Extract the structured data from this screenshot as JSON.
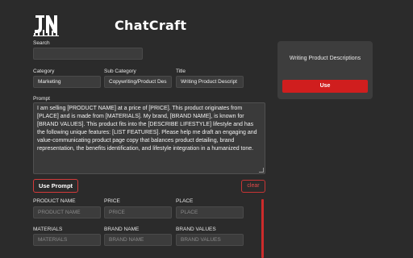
{
  "app": {
    "title": "ChatCraft",
    "logo_text": "JN"
  },
  "search": {
    "label": "Search",
    "value": ""
  },
  "category": {
    "label": "Category",
    "value": "Marketing"
  },
  "sub_category": {
    "label": "Sub Category",
    "value": "Copywriting/Product Des"
  },
  "title_field": {
    "label": "Title",
    "value": "Writing Product Descript"
  },
  "prompt": {
    "label": "Prompt",
    "text": "I am selling [PRODUCT NAME] at a price of [PRICE]. This product originates from [PLACE] and is made from [MATERIALS]. My brand, [BRAND NAME], is known for [BRAND VALUES]. This product fits into the [DESCRIBE LIFESTYLE] lifestyle and has the following unique features: [LIST FEATURES]. Please help me draft an engaging and value-communicating product page copy that balances product detailing, brand representation, the benefits identification, and lifestyle integration in a humanized tone."
  },
  "buttons": {
    "use_prompt": "Use Prompt",
    "clear": "clear"
  },
  "variables": [
    {
      "label": "PRODUCT NAME",
      "placeholder": "PRODUCT NAME"
    },
    {
      "label": "PRICE",
      "placeholder": "PRICE"
    },
    {
      "label": "PLACE",
      "placeholder": "PLACE"
    },
    {
      "label": "MATERIALS",
      "placeholder": "MATERIALS"
    },
    {
      "label": "BRAND NAME",
      "placeholder": "BRAND NAME"
    },
    {
      "label": "BRAND VALUES",
      "placeholder": "BRAND VALUES"
    }
  ],
  "side_card": {
    "title": "Writing Product Descriptions",
    "button": "Use"
  },
  "colors": {
    "background": "#2b2b2b",
    "accent": "#d01e1e",
    "card": "#3d3d3d",
    "input": "#3c3c3c"
  }
}
